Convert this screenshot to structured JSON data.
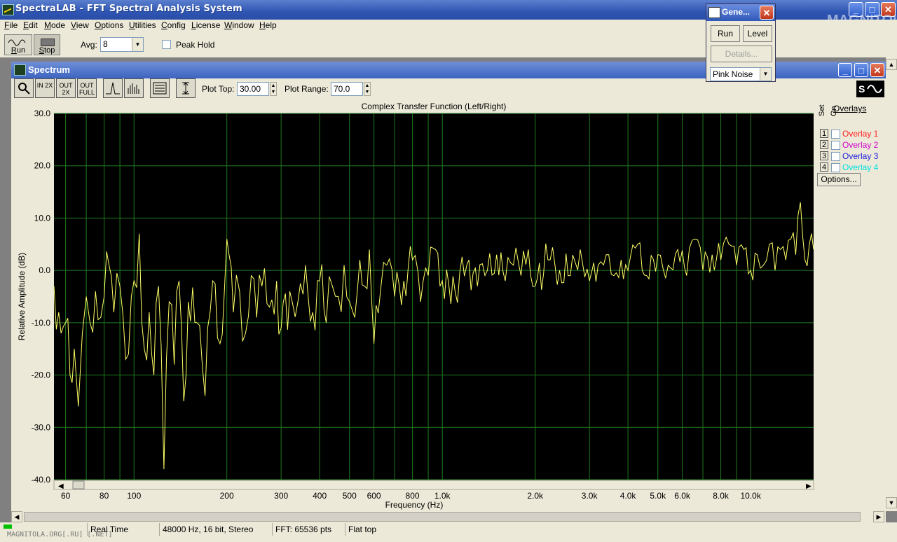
{
  "app": {
    "title": "SpectraLAB - FFT Spectral Analysis System",
    "watermark": "MAGNITOLA",
    "watermark_sub": "MAGNITOLA.ORG[.RU] [.NET]"
  },
  "menu": [
    "File",
    "Edit",
    "Mode",
    "View",
    "Options",
    "Utilities",
    "Config",
    "License",
    "Window",
    "Help"
  ],
  "toolbar": {
    "run_label": "Run",
    "stop_label": "Stop",
    "avg_label": "Avg:",
    "avg_value": "8",
    "peak_hold_label": "Peak Hold"
  },
  "generator": {
    "title": "Gene...",
    "run_label": "Run",
    "level_label": "Level",
    "details_label": "Details...",
    "signal_value": "Pink Noise"
  },
  "spectrum": {
    "window_title": "Spectrum",
    "tool_icons": [
      "zoom-icon",
      "zoom-in-2x-icon",
      "zoom-out-2x-icon",
      "zoom-out-full-icon",
      "peak-icon",
      "bars-icon",
      "table-icon",
      "scale-icon"
    ],
    "zoom_labels": [
      "IN 2X",
      "OUT 2X",
      "OUT FULL"
    ],
    "plot_top_label": "Plot Top:",
    "plot_top_value": "30.00",
    "plot_range_label": "Plot Range:",
    "plot_range_value": "70.0",
    "overlays_header": "Overlays",
    "set_label": "Set",
    "on_label": "On",
    "overlays": [
      {
        "num": "1",
        "name": "Overlay 1",
        "color": "#ff2020"
      },
      {
        "num": "2",
        "name": "Overlay 2",
        "color": "#d000d0"
      },
      {
        "num": "3",
        "name": "Overlay 3",
        "color": "#2020e0"
      },
      {
        "num": "4",
        "name": "Overlay 4",
        "color": "#00e0e0"
      }
    ],
    "options_label": "Options..."
  },
  "status": {
    "mode": "Real Time",
    "format": "48000 Hz, 16 bit, Stereo",
    "fft": "FFT: 65536 pts",
    "window": "Flat top"
  },
  "chart_data": {
    "type": "line",
    "title": "Complex Transfer Function (Left/Right)",
    "xlabel": "Frequency (Hz)",
    "ylabel": "Relative Amplitude (dB)",
    "x_scale": "log",
    "xlim": [
      55,
      16000
    ],
    "ylim": [
      -40,
      30
    ],
    "y_ticks": [
      "30.0",
      "20.0",
      "10.0",
      "0.0",
      "-10.0",
      "-20.0",
      "-30.0",
      "-40.0"
    ],
    "x_ticks": [
      {
        "v": 60,
        "l": "60"
      },
      {
        "v": 80,
        "l": "80"
      },
      {
        "v": 100,
        "l": "100"
      },
      {
        "v": 200,
        "l": "200"
      },
      {
        "v": 300,
        "l": "300"
      },
      {
        "v": 400,
        "l": "400"
      },
      {
        "v": 500,
        "l": "500"
      },
      {
        "v": 600,
        "l": "600"
      },
      {
        "v": 800,
        "l": "800"
      },
      {
        "v": 1000,
        "l": "1.0k"
      },
      {
        "v": 2000,
        "l": "2.0k"
      },
      {
        "v": 3000,
        "l": "3.0k"
      },
      {
        "v": 4000,
        "l": "4.0k"
      },
      {
        "v": 5000,
        "l": "5.0k"
      },
      {
        "v": 6000,
        "l": "6.0k"
      },
      {
        "v": 8000,
        "l": "8.0k"
      },
      {
        "v": 10000,
        "l": "10.0k"
      }
    ],
    "background": "#000000",
    "grid_color": "#1f7a1f",
    "line_color": "#ffff66",
    "series": [
      {
        "x": [
          55,
          57,
          58,
          60,
          62,
          64,
          66,
          68,
          70,
          72,
          75,
          78,
          80,
          83,
          86,
          90,
          94,
          98,
          100,
          104,
          108,
          112,
          116,
          120,
          125,
          130,
          135,
          140,
          145,
          150,
          160,
          170,
          180,
          190,
          200,
          210,
          220,
          230,
          240,
          250,
          260,
          275,
          290,
          300,
          320,
          340,
          360,
          380,
          400,
          420,
          440,
          460,
          480,
          500,
          520,
          540,
          560,
          580,
          600,
          630,
          660,
          700,
          750,
          800,
          850,
          900,
          950,
          1000,
          1100,
          1200,
          1300,
          1400,
          1500,
          1600,
          1700,
          1800,
          1900,
          2000,
          2200,
          2400,
          2600,
          2800,
          3000,
          3200,
          3400,
          3600,
          3800,
          4000,
          4300,
          4600,
          5000,
          5400,
          5800,
          6200,
          6600,
          7000,
          7500,
          8000,
          8500,
          9000,
          9500,
          10000,
          10500,
          11000,
          11500,
          12000,
          12500,
          13000,
          13500,
          14000,
          14500,
          15000,
          15500,
          16000
        ],
        "y": [
          -3,
          -8,
          -12,
          -10,
          -20,
          -15,
          -26,
          -12,
          -5,
          -10,
          -4,
          -9,
          -5,
          1,
          -8,
          -3,
          -17,
          -5,
          -2,
          7,
          -15,
          -8,
          -20,
          -3,
          -38,
          -6,
          -18,
          -2,
          -25,
          -6,
          -10,
          -24,
          -2,
          -14,
          6,
          -8,
          -4,
          -12,
          -1,
          -9,
          -3,
          -7,
          -2,
          -11,
          -4,
          -6,
          1,
          -8,
          -2,
          -10,
          -3,
          -5,
          1,
          -6,
          -9,
          2,
          -3,
          4,
          -14,
          -4,
          1,
          -5,
          -2,
          2,
          -6,
          -1,
          4,
          -2,
          -4,
          1,
          -3,
          0,
          3,
          -2,
          1,
          -1,
          4,
          -3,
          2,
          0,
          -1,
          4,
          -2,
          1,
          3,
          -1,
          2,
          0,
          5,
          -1,
          3,
          1,
          4,
          -1,
          6,
          0,
          3,
          2,
          5,
          1,
          4,
          0,
          3,
          1,
          5,
          0,
          4,
          2,
          6,
          3,
          13,
          2,
          5,
          4
        ]
      }
    ]
  }
}
